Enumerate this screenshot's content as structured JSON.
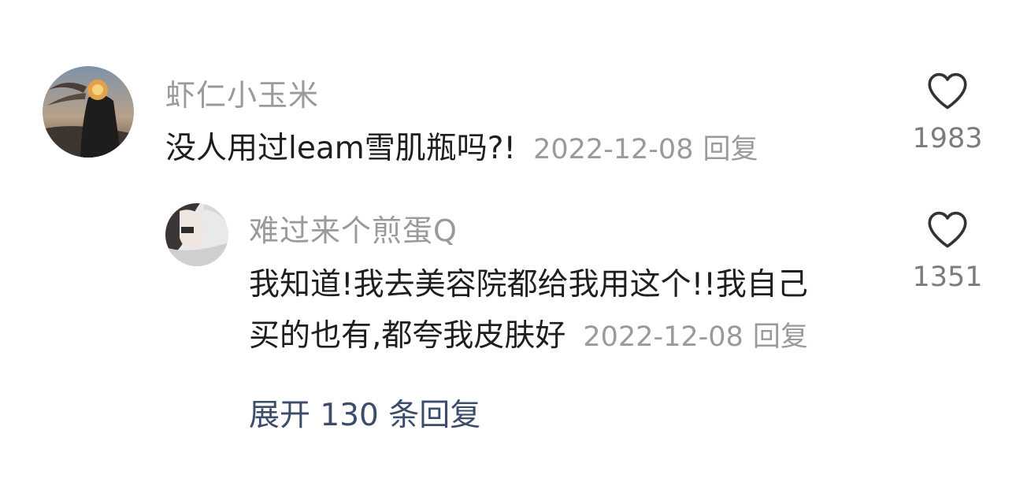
{
  "comments": [
    {
      "username": "虾仁小玉米",
      "text": "没人用过leam雪肌瓶吗?!",
      "date": "2022-12-08",
      "reply_label": "回复",
      "likes": "1983",
      "like_icon": "heart-outline-icon"
    },
    {
      "username": "难过来个煎蛋Q",
      "text_line1": "我知道!我去美容院都给我用这个!!我自己",
      "text_line2": "买的也有,都夸我皮肤好",
      "date": "2022-12-08",
      "reply_label": "回复",
      "likes": "1351",
      "like_icon": "heart-outline-icon"
    }
  ],
  "expand_replies": "展开 130 条回复",
  "colors": {
    "username": "#9a9a9a",
    "body_text": "#1e1e1e",
    "meta": "#9a9a9a",
    "expand_link": "#3b4d6a"
  }
}
